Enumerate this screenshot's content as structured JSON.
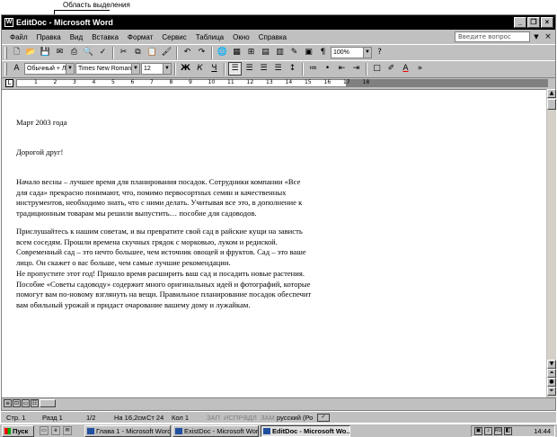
{
  "callout": {
    "label": "Область выделения"
  },
  "window": {
    "title": "EditDoc - Microsoft Word",
    "buttons": [
      "_",
      "❐",
      "×"
    ]
  },
  "menu": [
    "Файл",
    "Правка",
    "Вид",
    "Вставка",
    "Формат",
    "Сервис",
    "Таблица",
    "Окно",
    "Справка"
  ],
  "ask": {
    "placeholder": "Введите вопрос"
  },
  "toolbar1": {
    "zoom": "100%"
  },
  "toolbar2": {
    "style": "Обычный + Лес",
    "font": "Times New Roman",
    "size": "12",
    "bold": "Ж",
    "italic": "К",
    "underline": "Ч"
  },
  "ruler": {
    "marks": [
      "1",
      "2",
      "3",
      "4",
      "5",
      "6",
      "7",
      "8",
      "9",
      "10",
      "11",
      "12",
      "13",
      "14",
      "15",
      "16",
      "17",
      "18"
    ]
  },
  "document": {
    "date": "Март 2003 года",
    "greeting": "Дорогой друг!",
    "p1": [
      "Начало весны – лучшее время для планирования посадок. Сотрудники компании «Все",
      "для сада» прекрасно понимают, что, помимо первосортных семян и качественных",
      "инструментов, необходимо знать, что с ними делать. Учитывая все это, в дополнение к",
      "традиционным товарам мы решили выпустить… пособие для садоводов."
    ],
    "p2": [
      "Прислушайтесь к нашим советам, и вы превратите свой сад в райские кущи на зависть",
      "всем соседям. Прошли времена скучных грядок с морковью, луком и редиской.",
      "Современный сад – это нечто большее, чем источник овощей и фруктов. Сад – это ваше",
      "лицо. Он скажет о вас больше, чем самые лучшие рекомендации."
    ],
    "p3": [
      "Не пропустите этот год! Пришло время расширить ваш сад и посадить новые растения.",
      "Пособие «Советы садоводу» содержит много оригинальных идей и фотографий, которые",
      "помогут вам по-новому взглянуть на вещи. Правильное планирование посадок обеспечит",
      "вам обильный урожай и придаст очарование вашему дому и лужайкам."
    ]
  },
  "status": {
    "page": "Стр. 1",
    "section": "Разд 1",
    "pages": "1/2",
    "at": "На 16,2см",
    "line": "Ст 24",
    "col": "Кол 1",
    "rec": "ЗАП",
    "trk": "ИСПР",
    "ext": "ВДЛ",
    "ovr": "ЗАМ",
    "lang": "русский (Ро"
  },
  "taskbar": {
    "start": "Пуск",
    "tasks": [
      "Глава 1 - Microsoft Word",
      "ExistDoc - Microsoft Word",
      "EditDoc - Microsoft Wo..."
    ],
    "tray_lang": "RU",
    "clock": "14:44"
  }
}
